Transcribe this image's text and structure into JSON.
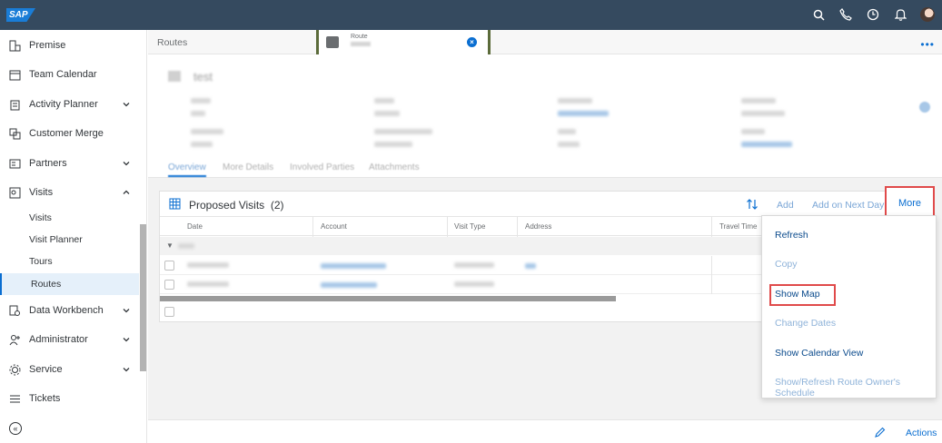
{
  "shell": {
    "logo_text": "SAP",
    "icons": [
      "search-icon",
      "phone-icon",
      "clock-icon",
      "bell-icon",
      "user-avatar"
    ]
  },
  "sidebar": {
    "items": [
      {
        "label": "Premise",
        "icon": "premise-icon"
      },
      {
        "label": "Team Calendar",
        "icon": "calendar-icon"
      },
      {
        "label": "Activity Planner",
        "icon": "clipboard-icon",
        "expandable": true
      },
      {
        "label": "Customer Merge",
        "icon": "merge-icon"
      },
      {
        "label": "Partners",
        "icon": "partners-icon",
        "expandable": true
      },
      {
        "label": "Visits",
        "icon": "visits-icon",
        "expanded": true
      },
      {
        "label": "Data Workbench",
        "icon": "workbench-icon",
        "expandable": true
      },
      {
        "label": "Administrator",
        "icon": "admin-icon",
        "expandable": true
      },
      {
        "label": "Service",
        "icon": "service-icon",
        "expandable": true
      },
      {
        "label": "Tickets",
        "icon": "tickets-icon"
      }
    ],
    "sub_items": [
      "Visits",
      "Visit Planner",
      "Tours",
      "Routes"
    ],
    "active_sub_item": "Routes"
  },
  "tabs_bar": {
    "routes_label": "Routes",
    "route_tab_label": "Route",
    "more_icon": "overflow-icon"
  },
  "header": {
    "title": "test"
  },
  "card": {
    "title": "Proposed Visits",
    "count": "(2)",
    "toolbar": {
      "add_label": "Add",
      "add_next_day_label": "Add on Next Day",
      "more_label": "More"
    },
    "columns": [
      "Date",
      "Account",
      "Visit Type",
      "Address",
      "Travel Time"
    ]
  },
  "menu": {
    "items": [
      {
        "label": "Refresh",
        "enabled": true
      },
      {
        "label": "Copy",
        "enabled": false
      },
      {
        "label": "Show Map",
        "enabled": true,
        "highlighted": true
      },
      {
        "label": "Change Dates",
        "enabled": false
      },
      {
        "label": "Show Calendar View",
        "enabled": true
      },
      {
        "label": "Show/Refresh Route Owner's Schedule",
        "enabled": false
      }
    ]
  },
  "footer": {
    "actions_label": "Actions"
  },
  "colors": {
    "shell_bg": "#354a5f",
    "accent": "#0a6ed1",
    "highlight_border": "#e04a4a"
  }
}
